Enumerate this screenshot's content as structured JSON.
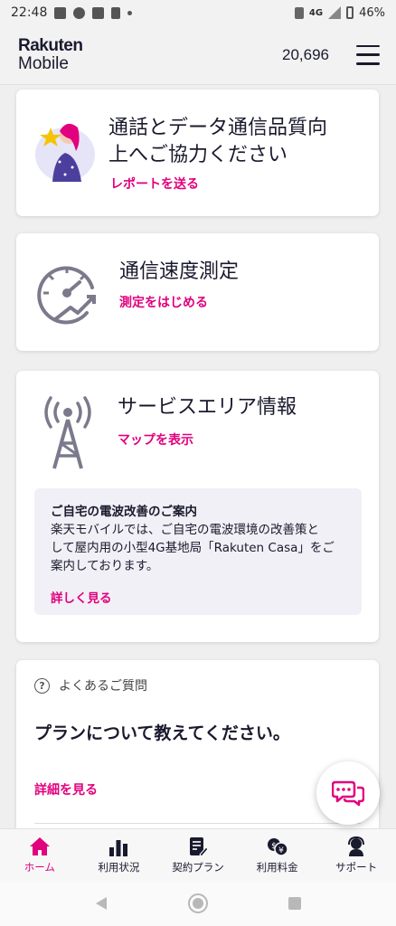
{
  "status_bar": {
    "time": "22:48",
    "network": "4G",
    "battery": "46%"
  },
  "header": {
    "logo_line1": "Rakuten",
    "logo_line2": "Mobile",
    "points": "20,696",
    "menu_icon": "hamburger-icon"
  },
  "cards": {
    "quality": {
      "title_line1": "通話とデータ通信品質向",
      "title_line2": "上へご協力ください",
      "link": "レポートを送る",
      "icon": "woman-with-star-illustration"
    },
    "speed": {
      "title": "通信速度測定",
      "link": "測定をはじめる",
      "icon": "speedometer-icon"
    },
    "area": {
      "title": "サービスエリア情報",
      "link": "マップを表示",
      "icon": "antenna-tower-icon",
      "notice": {
        "title": "ご自宅の電波改善のご案内",
        "body_line1": "楽天モバイルでは、ご自宅の電波環境の改善策と",
        "body_line2": "して屋内用の小型4G基地局「Rakuten Casa」をご",
        "body_line3": "案内しております。",
        "link": "詳しく見る"
      }
    },
    "faq": {
      "header": "よくあるご質問",
      "question": "プランについて教えてください。",
      "link": "詳細を見る"
    }
  },
  "chat_fab": {
    "icon": "chat-bubbles-icon"
  },
  "bottom_nav": [
    {
      "label": "ホーム",
      "icon": "home-icon",
      "active": true
    },
    {
      "label": "利用状況",
      "icon": "bar-chart-icon",
      "active": false
    },
    {
      "label": "契約プラン",
      "icon": "contract-icon",
      "active": false
    },
    {
      "label": "利用料金",
      "icon": "fee-icon",
      "active": false
    },
    {
      "label": "サポート",
      "icon": "support-icon",
      "active": false
    }
  ],
  "colors": {
    "accent": "#e1007e",
    "text": "#1a1a2e",
    "icon_gray": "#7b7a8c",
    "notice_bg": "#f1f0f6"
  }
}
